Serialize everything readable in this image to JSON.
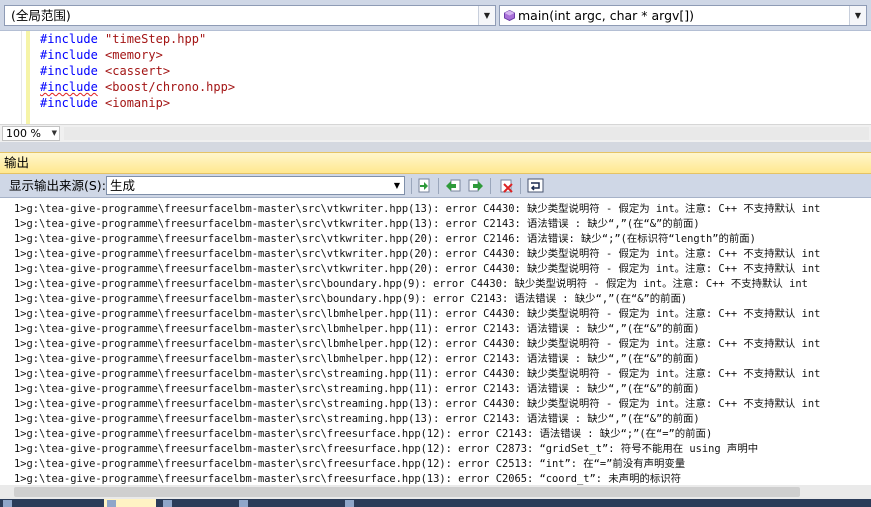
{
  "navbar": {
    "scope": "(全局范围)",
    "function": "main(int argc, char * argv[])",
    "function_icon": "method-icon"
  },
  "editor": {
    "lines": [
      {
        "kw": "#include",
        "sp": " ",
        "arg": "\"timeStep.hpp\"",
        "squiggle": false
      },
      {
        "kw": "#include",
        "sp": " ",
        "arg": "<memory>",
        "squiggle": false
      },
      {
        "kw": "#include",
        "sp": " ",
        "arg": "<cassert>",
        "squiggle": false
      },
      {
        "kw": "#include",
        "sp": " ",
        "arg": "<boost/chrono.hpp>",
        "squiggle": true
      },
      {
        "kw": "#include",
        "sp": " ",
        "arg": "<iomanip>",
        "squiggle": false
      }
    ],
    "zoom": "100 %"
  },
  "output": {
    "title": "输出",
    "source_label": "显示输出来源(S):",
    "source_value": "生成",
    "lines": [
      "1>g:\\tea-give-programme\\freesurfacelbm-master\\src\\vtkwriter.hpp(13): error C4430: 缺少类型说明符 - 假定为 int。注意: C++ 不支持默认 int",
      "1>g:\\tea-give-programme\\freesurfacelbm-master\\src\\vtkwriter.hpp(13): error C2143: 语法错误 : 缺少“,”(在“&”的前面)",
      "1>g:\\tea-give-programme\\freesurfacelbm-master\\src\\vtkwriter.hpp(20): error C2146: 语法错误: 缺少“;”(在标识符“length”的前面)",
      "1>g:\\tea-give-programme\\freesurfacelbm-master\\src\\vtkwriter.hpp(20): error C4430: 缺少类型说明符 - 假定为 int。注意: C++ 不支持默认 int",
      "1>g:\\tea-give-programme\\freesurfacelbm-master\\src\\vtkwriter.hpp(20): error C4430: 缺少类型说明符 - 假定为 int。注意: C++ 不支持默认 int",
      "1>g:\\tea-give-programme\\freesurfacelbm-master\\src\\boundary.hpp(9): error C4430: 缺少类型说明符 - 假定为 int。注意: C++ 不支持默认 int",
      "1>g:\\tea-give-programme\\freesurfacelbm-master\\src\\boundary.hpp(9): error C2143: 语法错误 : 缺少“,”(在“&”的前面)",
      "1>g:\\tea-give-programme\\freesurfacelbm-master\\src\\lbmhelper.hpp(11): error C4430: 缺少类型说明符 - 假定为 int。注意: C++ 不支持默认 int",
      "1>g:\\tea-give-programme\\freesurfacelbm-master\\src\\lbmhelper.hpp(11): error C2143: 语法错误 : 缺少“,”(在“&”的前面)",
      "1>g:\\tea-give-programme\\freesurfacelbm-master\\src\\lbmhelper.hpp(12): error C4430: 缺少类型说明符 - 假定为 int。注意: C++ 不支持默认 int",
      "1>g:\\tea-give-programme\\freesurfacelbm-master\\src\\lbmhelper.hpp(12): error C2143: 语法错误 : 缺少“,”(在“&”的前面)",
      "1>g:\\tea-give-programme\\freesurfacelbm-master\\src\\streaming.hpp(11): error C4430: 缺少类型说明符 - 假定为 int。注意: C++ 不支持默认 int",
      "1>g:\\tea-give-programme\\freesurfacelbm-master\\src\\streaming.hpp(11): error C2143: 语法错误 : 缺少“,”(在“&”的前面)",
      "1>g:\\tea-give-programme\\freesurfacelbm-master\\src\\streaming.hpp(13): error C4430: 缺少类型说明符 - 假定为 int。注意: C++ 不支持默认 int",
      "1>g:\\tea-give-programme\\freesurfacelbm-master\\src\\streaming.hpp(13): error C2143: 语法错误 : 缺少“,”(在“&”的前面)",
      "1>g:\\tea-give-programme\\freesurfacelbm-master\\src\\freesurface.hpp(12): error C2143: 语法错误 : 缺少“;”(在“=”的前面)",
      "1>g:\\tea-give-programme\\freesurfacelbm-master\\src\\freesurface.hpp(12): error C2873: “gridSet_t”: 符号不能用在 using 声明中",
      "1>g:\\tea-give-programme\\freesurfacelbm-master\\src\\freesurface.hpp(12): error C2513: “int”: 在“=”前没有声明变量",
      "1>g:\\tea-give-programme\\freesurfacelbm-master\\src\\freesurface.hpp(13): error C2065: “coord_t”: 未声明的标识符"
    ]
  },
  "toolbar_icons": [
    "go-to-line-icon",
    "previous-message-icon",
    "next-message-icon",
    "clear-all-icon",
    "word-wrap-icon"
  ],
  "colors": {
    "navbar_bg": "#cfd7e6",
    "output_title_bg": "#ffe88f",
    "keyword": "#0000ff",
    "string": "#a31515"
  }
}
